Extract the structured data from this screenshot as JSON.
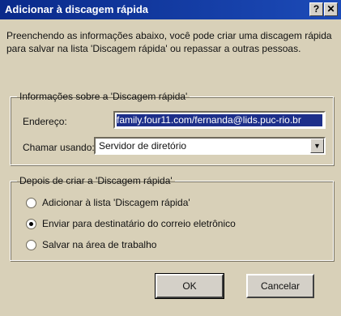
{
  "titlebar": {
    "title": "Adicionar à discagem rápida",
    "help_label": "?",
    "close_label": "✕"
  },
  "description": "Preenchendo as informações abaixo, você pode criar uma discagem rápida para salvar na lista 'Discagem rápida' ou repassar a outras pessoas.",
  "info_group": {
    "title": "Informações sobre a 'Discagem rápida'",
    "address_label": "Endereço:",
    "address_value": "family.four11.com/fernanda@lids.puc-rio.br",
    "call_using_label": "Chamar usando:",
    "call_using_value": "Servidor de diretório",
    "dropdown_glyph": "▼"
  },
  "after_group": {
    "title": "Depois de criar a 'Discagem rápida'",
    "options": [
      {
        "label": "Adicionar à lista 'Discagem rápida'",
        "selected": false
      },
      {
        "label": "Enviar para destinatário do correio eletrônico",
        "selected": true
      },
      {
        "label": "Salvar na área de trabalho",
        "selected": false
      }
    ]
  },
  "buttons": {
    "ok": "OK",
    "cancel": "Cancelar"
  }
}
